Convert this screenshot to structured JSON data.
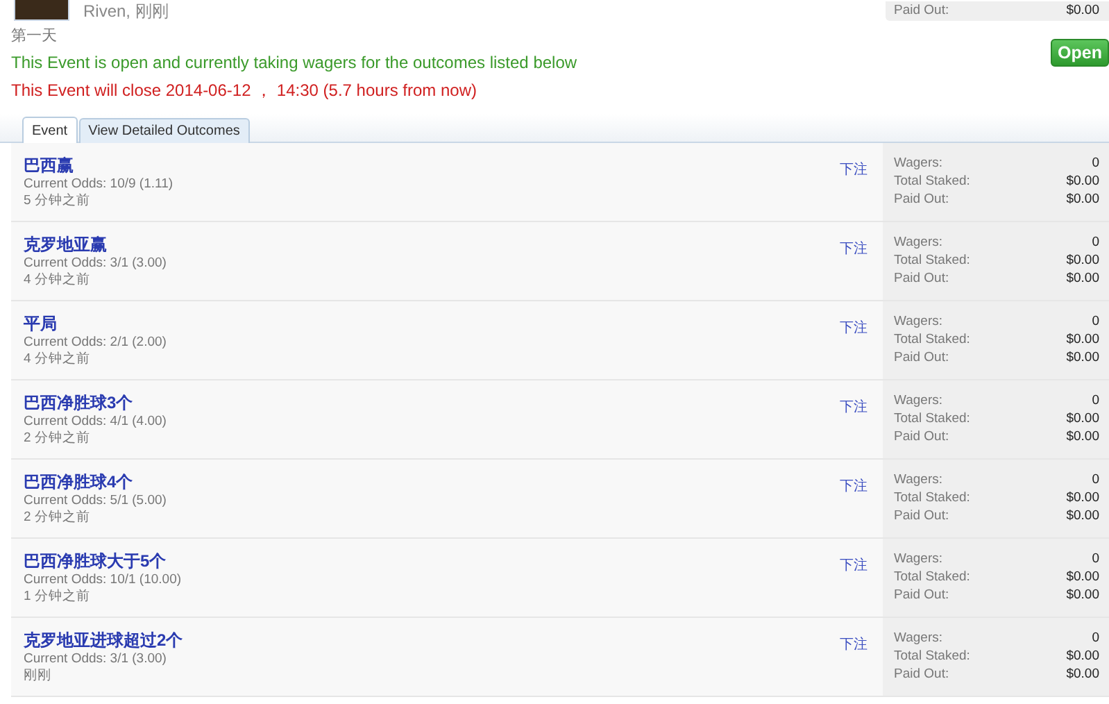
{
  "header": {
    "author_line": "Riven, 刚刚",
    "summary": [
      {
        "label": "Paid Out:",
        "value": "$0.00"
      }
    ]
  },
  "day_title": "第一天",
  "open_message": "This Event is open and currently taking wagers for the outcomes listed below",
  "close_message": "This Event will close 2014-06-12 ， 14:30 (5.7 hours from now)",
  "status_badge": "Open",
  "tabs": [
    {
      "label": "Event",
      "selected": true
    },
    {
      "label": "View Detailed Outcomes",
      "selected": false
    }
  ],
  "outcomes": [
    {
      "name": "巴西赢",
      "odds": "Current Odds: 10/9 (1.11)",
      "time": "5 分钟之前",
      "bet_link": "下注",
      "stats": [
        {
          "label": "Wagers:",
          "value": "0"
        },
        {
          "label": "Total Staked:",
          "value": "$0.00"
        },
        {
          "label": "Paid Out:",
          "value": "$0.00"
        }
      ]
    },
    {
      "name": "克罗地亚赢",
      "odds": "Current Odds: 3/1 (3.00)",
      "time": "4 分钟之前",
      "bet_link": "下注",
      "stats": [
        {
          "label": "Wagers:",
          "value": "0"
        },
        {
          "label": "Total Staked:",
          "value": "$0.00"
        },
        {
          "label": "Paid Out:",
          "value": "$0.00"
        }
      ]
    },
    {
      "name": "平局",
      "odds": "Current Odds: 2/1 (2.00)",
      "time": "4 分钟之前",
      "bet_link": "下注",
      "stats": [
        {
          "label": "Wagers:",
          "value": "0"
        },
        {
          "label": "Total Staked:",
          "value": "$0.00"
        },
        {
          "label": "Paid Out:",
          "value": "$0.00"
        }
      ]
    },
    {
      "name": "巴西净胜球3个",
      "odds": "Current Odds: 4/1 (4.00)",
      "time": "2 分钟之前",
      "bet_link": "下注",
      "stats": [
        {
          "label": "Wagers:",
          "value": "0"
        },
        {
          "label": "Total Staked:",
          "value": "$0.00"
        },
        {
          "label": "Paid Out:",
          "value": "$0.00"
        }
      ]
    },
    {
      "name": "巴西净胜球4个",
      "odds": "Current Odds: 5/1 (5.00)",
      "time": "2 分钟之前",
      "bet_link": "下注",
      "stats": [
        {
          "label": "Wagers:",
          "value": "0"
        },
        {
          "label": "Total Staked:",
          "value": "$0.00"
        },
        {
          "label": "Paid Out:",
          "value": "$0.00"
        }
      ]
    },
    {
      "name": "巴西净胜球大于5个",
      "odds": "Current Odds: 10/1 (10.00)",
      "time": "1 分钟之前",
      "bet_link": "下注",
      "stats": [
        {
          "label": "Wagers:",
          "value": "0"
        },
        {
          "label": "Total Staked:",
          "value": "$0.00"
        },
        {
          "label": "Paid Out:",
          "value": "$0.00"
        }
      ]
    },
    {
      "name": "克罗地亚进球超过2个",
      "odds": "Current Odds: 3/1 (3.00)",
      "time": "刚刚",
      "bet_link": "下注",
      "stats": [
        {
          "label": "Wagers:",
          "value": "0"
        },
        {
          "label": "Total Staked:",
          "value": "$0.00"
        },
        {
          "label": "Paid Out:",
          "value": "$0.00"
        }
      ]
    }
  ]
}
